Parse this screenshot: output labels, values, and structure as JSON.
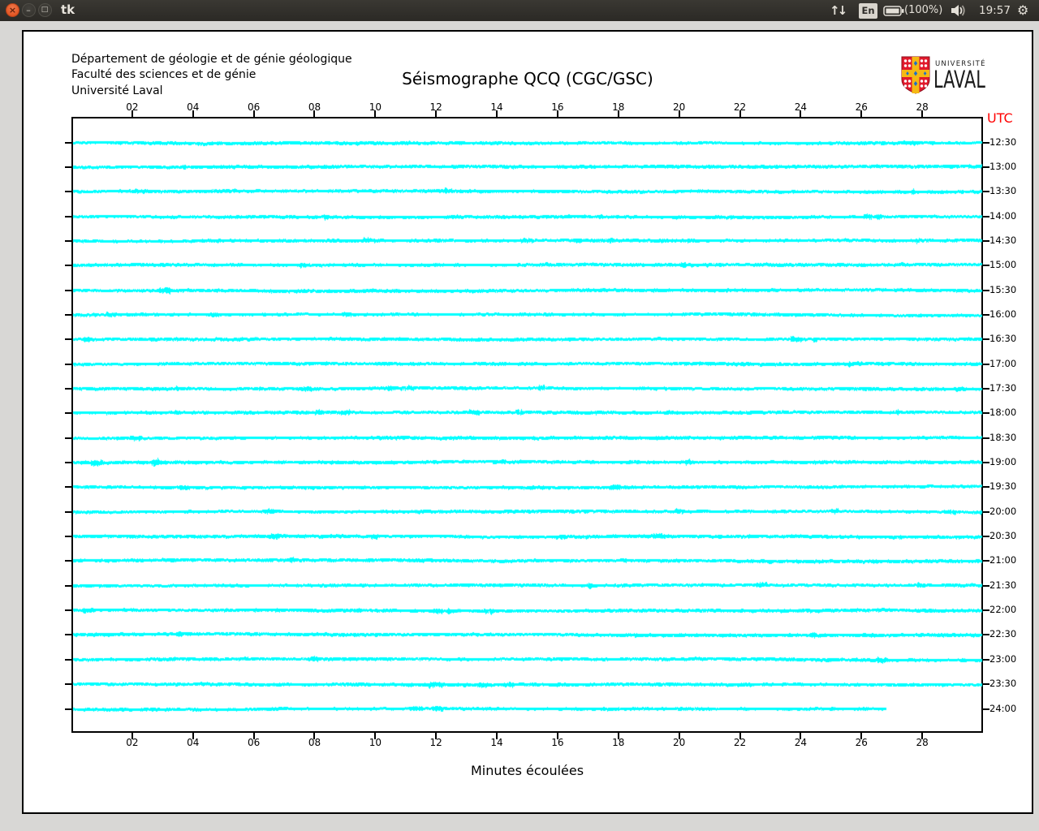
{
  "titlebar": {
    "title": "tk",
    "keyboard": "En",
    "battery": "(100%)",
    "clock": "19:57"
  },
  "window": {
    "dept_lines": [
      "Département de géologie et de génie géologique",
      "Faculté des sciences et de génie",
      "Université Laval"
    ],
    "title": "Séismographe QCQ (CGC/GSC)",
    "logo": {
      "small": "UNIVERSITÉ",
      "large": "LAVAL"
    },
    "utc_label": "UTC",
    "xlabel": "Minutes écoulées"
  },
  "chart_data": {
    "type": "line",
    "title": "Séismographe QCQ (CGC/GSC)",
    "xlabel": "Minutes écoulées",
    "x_tick_labels": [
      "02",
      "04",
      "06",
      "08",
      "10",
      "12",
      "14",
      "16",
      "18",
      "20",
      "22",
      "24",
      "26",
      "28"
    ],
    "x_range_minutes": [
      0,
      30
    ],
    "trace_labels": [
      "12:30",
      "13:00",
      "13:30",
      "14:00",
      "14:30",
      "15:00",
      "15:30",
      "16:00",
      "16:30",
      "17:00",
      "17:30",
      "18:00",
      "18:30",
      "19:00",
      "19:30",
      "20:00",
      "20:30",
      "21:00",
      "21:30",
      "22:00",
      "22:30",
      "23:00",
      "23:30",
      "24:00"
    ],
    "ylabel_right": "UTC",
    "trace_color": "#00FFFF",
    "last_trace_end_minute": 26.8,
    "grid": false,
    "legend": false
  }
}
